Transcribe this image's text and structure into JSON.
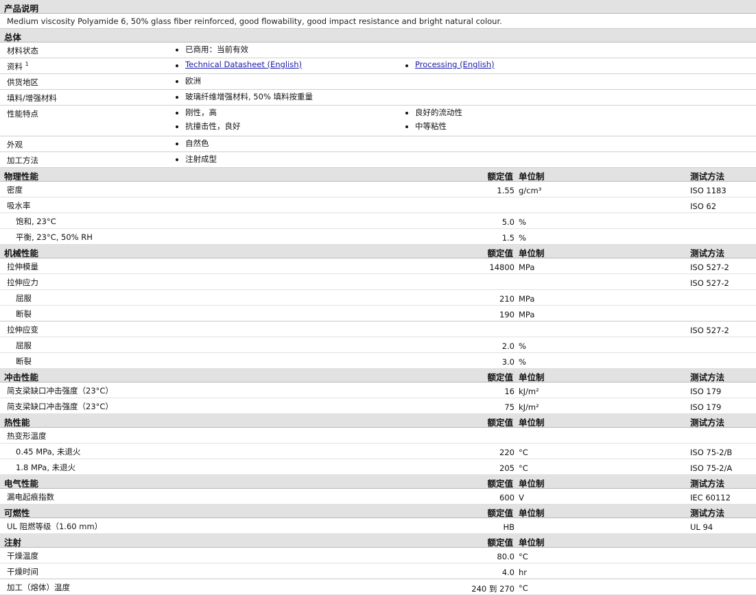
{
  "description": {
    "title": "产品说明",
    "text": "Medium viscosity Polyamide 6, 50% glass fiber reinforced, good flowability, good impact resistance and bright natural colour."
  },
  "general": {
    "title": "总体",
    "rows": [
      {
        "label": "材料状态",
        "items": [
          "已商用：当前有效"
        ]
      },
      {
        "label": "资料",
        "sup": "1",
        "items": [
          "Technical Datasheet (English)",
          "Processing (English)"
        ],
        "links": true
      },
      {
        "label": "供货地区",
        "items": [
          "欧洲"
        ]
      },
      {
        "label": "填料/增强材料",
        "items": [
          "玻璃纤维增强材料, 50% 填料按重量"
        ]
      },
      {
        "label": "性能特点",
        "items": [
          "刚性，高",
          "良好的流动性",
          "抗撞击性，良好",
          "中等粘性"
        ]
      },
      {
        "label": "外观",
        "items": [
          "自然色"
        ]
      },
      {
        "label": "加工方法",
        "items": [
          "注射成型"
        ]
      }
    ]
  },
  "headers": {
    "nominal": "额定值",
    "unit": "单位制",
    "test": "测试方法"
  },
  "sections": [
    {
      "title": "物理性能",
      "header": true,
      "rows": [
        {
          "label": "密度",
          "value": "1.55",
          "unit": "g/cm³",
          "method": "ISO 1183"
        },
        {
          "label": "吸水率",
          "method": "ISO 62"
        },
        {
          "label": "饱和, 23°C",
          "sub": true,
          "value": "5.0",
          "unit": "%"
        },
        {
          "label": "平衡, 23°C, 50% RH",
          "sub": true,
          "value": "1.5",
          "unit": "%"
        }
      ]
    },
    {
      "title": "机械性能",
      "header": true,
      "rows": [
        {
          "label": "拉伸模量",
          "value": "14800",
          "unit": "MPa",
          "method": "ISO 527-2"
        },
        {
          "label": "拉伸应力",
          "method": "ISO 527-2"
        },
        {
          "label": "屈服",
          "sub": true,
          "value": "210",
          "unit": "MPa"
        },
        {
          "label": "断裂",
          "sub": true,
          "value": "190",
          "unit": "MPa"
        },
        {
          "label": "拉伸应变",
          "method": "ISO 527-2"
        },
        {
          "label": "屈服",
          "sub": true,
          "value": "2.0",
          "unit": "%"
        },
        {
          "label": "断裂",
          "sub": true,
          "value": "3.0",
          "unit": "%"
        }
      ]
    },
    {
      "title": "冲击性能",
      "header": true,
      "rows": [
        {
          "label": "简支梁缺口冲击强度（23°C）",
          "value": "16",
          "unit": "kJ/m²",
          "method": "ISO 179"
        },
        {
          "label": "简支梁缺口冲击强度（23°C）",
          "value": "75",
          "unit": "kJ/m²",
          "method": "ISO 179"
        }
      ]
    },
    {
      "title": "热性能",
      "header": true,
      "rows": [
        {
          "label": "热变形温度"
        },
        {
          "label": "0.45 MPa, 未退火",
          "sub": true,
          "value": "220",
          "unit": "°C",
          "method": "ISO 75-2/B"
        },
        {
          "label": "1.8 MPa, 未退火",
          "sub": true,
          "value": "205",
          "unit": "°C",
          "method": "ISO 75-2/A"
        }
      ]
    },
    {
      "title": "电气性能",
      "header": true,
      "rows": [
        {
          "label": "漏电起痕指数",
          "value": "600",
          "unit": "V",
          "method": "IEC 60112"
        }
      ]
    },
    {
      "title": "可燃性",
      "header": true,
      "rows": [
        {
          "label": "UL 阻燃等级（1.60 mm）",
          "value": "HB",
          "method": "UL 94"
        }
      ]
    },
    {
      "title": "注射",
      "header": true,
      "noTest": true,
      "rows": [
        {
          "label": "干燥温度",
          "value": "80.0",
          "unit": "°C"
        },
        {
          "label": "干燥时间",
          "value": "4.0",
          "unit": "hr"
        },
        {
          "label": "加工（熔体）温度",
          "value": "240 到 270",
          "unit": "°C"
        }
      ]
    }
  ]
}
